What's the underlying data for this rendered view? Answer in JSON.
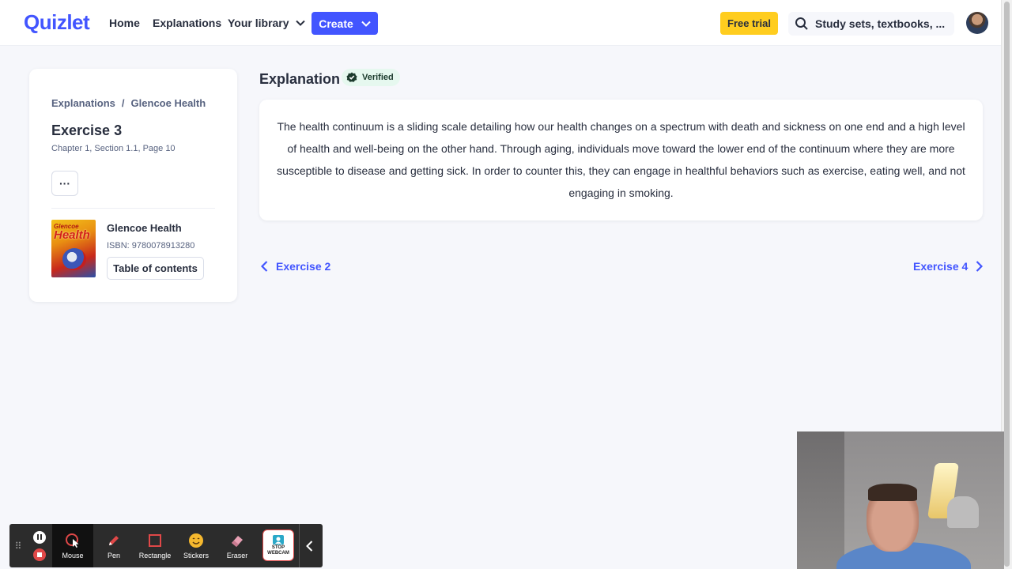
{
  "header": {
    "logo": "Quizlet",
    "nav": {
      "home": "Home",
      "explanations": "Explanations",
      "library": "Your library"
    },
    "create_label": "Create",
    "trial_label": "Free trial",
    "search_placeholder": "Study sets, textbooks, ..."
  },
  "sidebar": {
    "breadcrumb": [
      "Explanations",
      "/",
      "Glencoe Health"
    ],
    "exercise_title": "Exercise 3",
    "exercise_subtitle": "Chapter 1, Section 1.1, Page 10",
    "more_label": "···",
    "book": {
      "cover_top": "Glencoe",
      "cover_title": "Health",
      "title": "Glencoe Health",
      "isbn": "ISBN: 9780078913280",
      "toc_label": "Table of contents"
    }
  },
  "main": {
    "title": "Explanation",
    "badge": "Verified",
    "answer": "The health continuum is a sliding scale detailing how our health changes on a spectrum with death and sickness on one end and a high level of health and well-being on the other hand. Through aging, individuals move toward the lower end of the continuum where they are more susceptible to disease and getting sick. In order to counter this, they can engage in healthful behaviors such as exercise, eating well, and not engaging in smoking.",
    "prev_label": "Exercise 2",
    "next_label": "Exercise 4"
  },
  "recorder": {
    "tools": [
      "Mouse",
      "Pen",
      "Rectangle",
      "Stickers",
      "Eraser"
    ],
    "webcam_label_1": "STOP",
    "webcam_label_2": "WEBCAM"
  },
  "colors": {
    "brand": "#4255ff",
    "trial": "#ffcd1f",
    "verified_bg": "#e6f8ef",
    "text": "#282e3e",
    "muted": "#586380"
  }
}
